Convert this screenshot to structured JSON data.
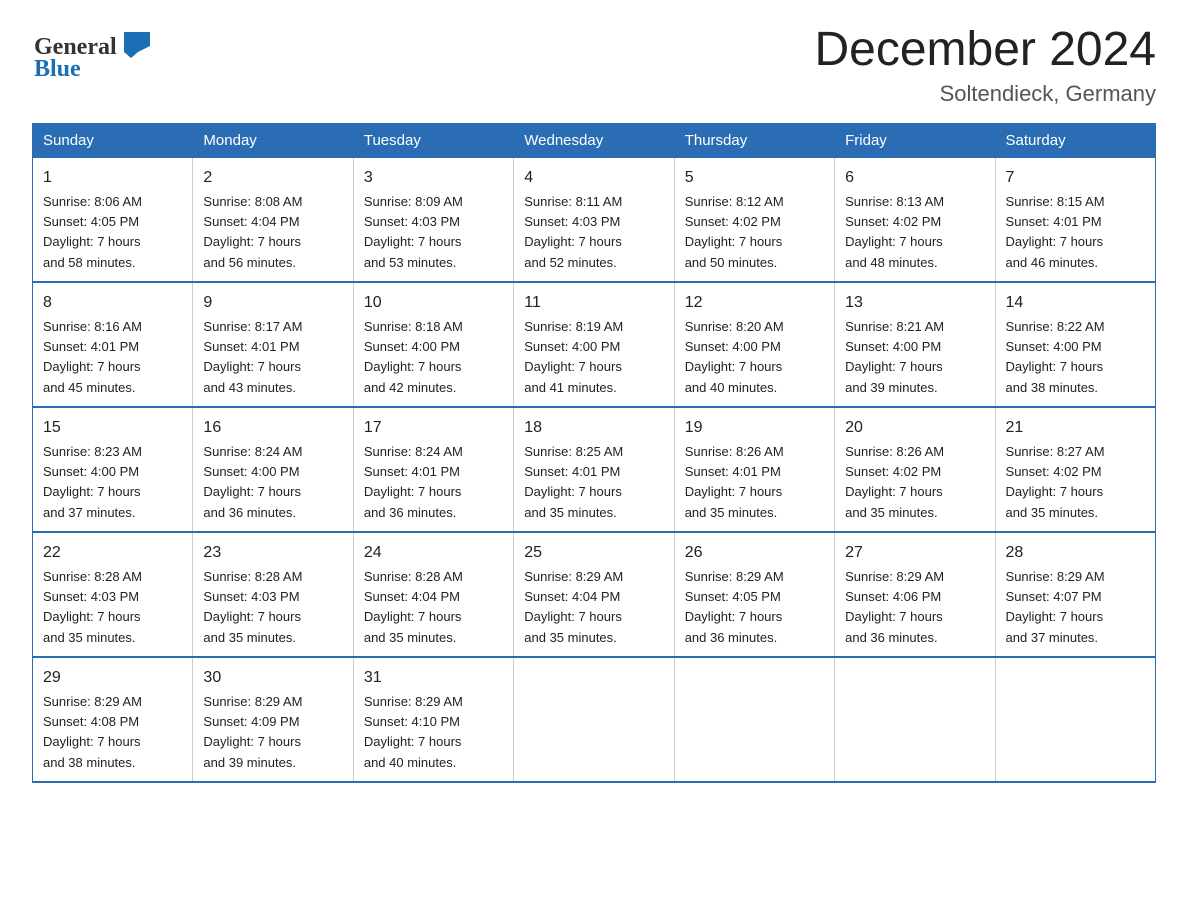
{
  "logo": {
    "line1": "General",
    "line2": "Blue"
  },
  "title": "December 2024",
  "subtitle": "Soltendieck, Germany",
  "columns": [
    "Sunday",
    "Monday",
    "Tuesday",
    "Wednesday",
    "Thursday",
    "Friday",
    "Saturday"
  ],
  "weeks": [
    [
      {
        "day": "1",
        "sunrise": "8:06 AM",
        "sunset": "4:05 PM",
        "daylight": "7 hours and 58 minutes."
      },
      {
        "day": "2",
        "sunrise": "8:08 AM",
        "sunset": "4:04 PM",
        "daylight": "7 hours and 56 minutes."
      },
      {
        "day": "3",
        "sunrise": "8:09 AM",
        "sunset": "4:03 PM",
        "daylight": "7 hours and 53 minutes."
      },
      {
        "day": "4",
        "sunrise": "8:11 AM",
        "sunset": "4:03 PM",
        "daylight": "7 hours and 52 minutes."
      },
      {
        "day": "5",
        "sunrise": "8:12 AM",
        "sunset": "4:02 PM",
        "daylight": "7 hours and 50 minutes."
      },
      {
        "day": "6",
        "sunrise": "8:13 AM",
        "sunset": "4:02 PM",
        "daylight": "7 hours and 48 minutes."
      },
      {
        "day": "7",
        "sunrise": "8:15 AM",
        "sunset": "4:01 PM",
        "daylight": "7 hours and 46 minutes."
      }
    ],
    [
      {
        "day": "8",
        "sunrise": "8:16 AM",
        "sunset": "4:01 PM",
        "daylight": "7 hours and 45 minutes."
      },
      {
        "day": "9",
        "sunrise": "8:17 AM",
        "sunset": "4:01 PM",
        "daylight": "7 hours and 43 minutes."
      },
      {
        "day": "10",
        "sunrise": "8:18 AM",
        "sunset": "4:00 PM",
        "daylight": "7 hours and 42 minutes."
      },
      {
        "day": "11",
        "sunrise": "8:19 AM",
        "sunset": "4:00 PM",
        "daylight": "7 hours and 41 minutes."
      },
      {
        "day": "12",
        "sunrise": "8:20 AM",
        "sunset": "4:00 PM",
        "daylight": "7 hours and 40 minutes."
      },
      {
        "day": "13",
        "sunrise": "8:21 AM",
        "sunset": "4:00 PM",
        "daylight": "7 hours and 39 minutes."
      },
      {
        "day": "14",
        "sunrise": "8:22 AM",
        "sunset": "4:00 PM",
        "daylight": "7 hours and 38 minutes."
      }
    ],
    [
      {
        "day": "15",
        "sunrise": "8:23 AM",
        "sunset": "4:00 PM",
        "daylight": "7 hours and 37 minutes."
      },
      {
        "day": "16",
        "sunrise": "8:24 AM",
        "sunset": "4:00 PM",
        "daylight": "7 hours and 36 minutes."
      },
      {
        "day": "17",
        "sunrise": "8:24 AM",
        "sunset": "4:01 PM",
        "daylight": "7 hours and 36 minutes."
      },
      {
        "day": "18",
        "sunrise": "8:25 AM",
        "sunset": "4:01 PM",
        "daylight": "7 hours and 35 minutes."
      },
      {
        "day": "19",
        "sunrise": "8:26 AM",
        "sunset": "4:01 PM",
        "daylight": "7 hours and 35 minutes."
      },
      {
        "day": "20",
        "sunrise": "8:26 AM",
        "sunset": "4:02 PM",
        "daylight": "7 hours and 35 minutes."
      },
      {
        "day": "21",
        "sunrise": "8:27 AM",
        "sunset": "4:02 PM",
        "daylight": "7 hours and 35 minutes."
      }
    ],
    [
      {
        "day": "22",
        "sunrise": "8:28 AM",
        "sunset": "4:03 PM",
        "daylight": "7 hours and 35 minutes."
      },
      {
        "day": "23",
        "sunrise": "8:28 AM",
        "sunset": "4:03 PM",
        "daylight": "7 hours and 35 minutes."
      },
      {
        "day": "24",
        "sunrise": "8:28 AM",
        "sunset": "4:04 PM",
        "daylight": "7 hours and 35 minutes."
      },
      {
        "day": "25",
        "sunrise": "8:29 AM",
        "sunset": "4:04 PM",
        "daylight": "7 hours and 35 minutes."
      },
      {
        "day": "26",
        "sunrise": "8:29 AM",
        "sunset": "4:05 PM",
        "daylight": "7 hours and 36 minutes."
      },
      {
        "day": "27",
        "sunrise": "8:29 AM",
        "sunset": "4:06 PM",
        "daylight": "7 hours and 36 minutes."
      },
      {
        "day": "28",
        "sunrise": "8:29 AM",
        "sunset": "4:07 PM",
        "daylight": "7 hours and 37 minutes."
      }
    ],
    [
      {
        "day": "29",
        "sunrise": "8:29 AM",
        "sunset": "4:08 PM",
        "daylight": "7 hours and 38 minutes."
      },
      {
        "day": "30",
        "sunrise": "8:29 AM",
        "sunset": "4:09 PM",
        "daylight": "7 hours and 39 minutes."
      },
      {
        "day": "31",
        "sunrise": "8:29 AM",
        "sunset": "4:10 PM",
        "daylight": "7 hours and 40 minutes."
      },
      null,
      null,
      null,
      null
    ]
  ],
  "labels": {
    "sunrise": "Sunrise:",
    "sunset": "Sunset:",
    "daylight": "Daylight: 7 hours"
  }
}
